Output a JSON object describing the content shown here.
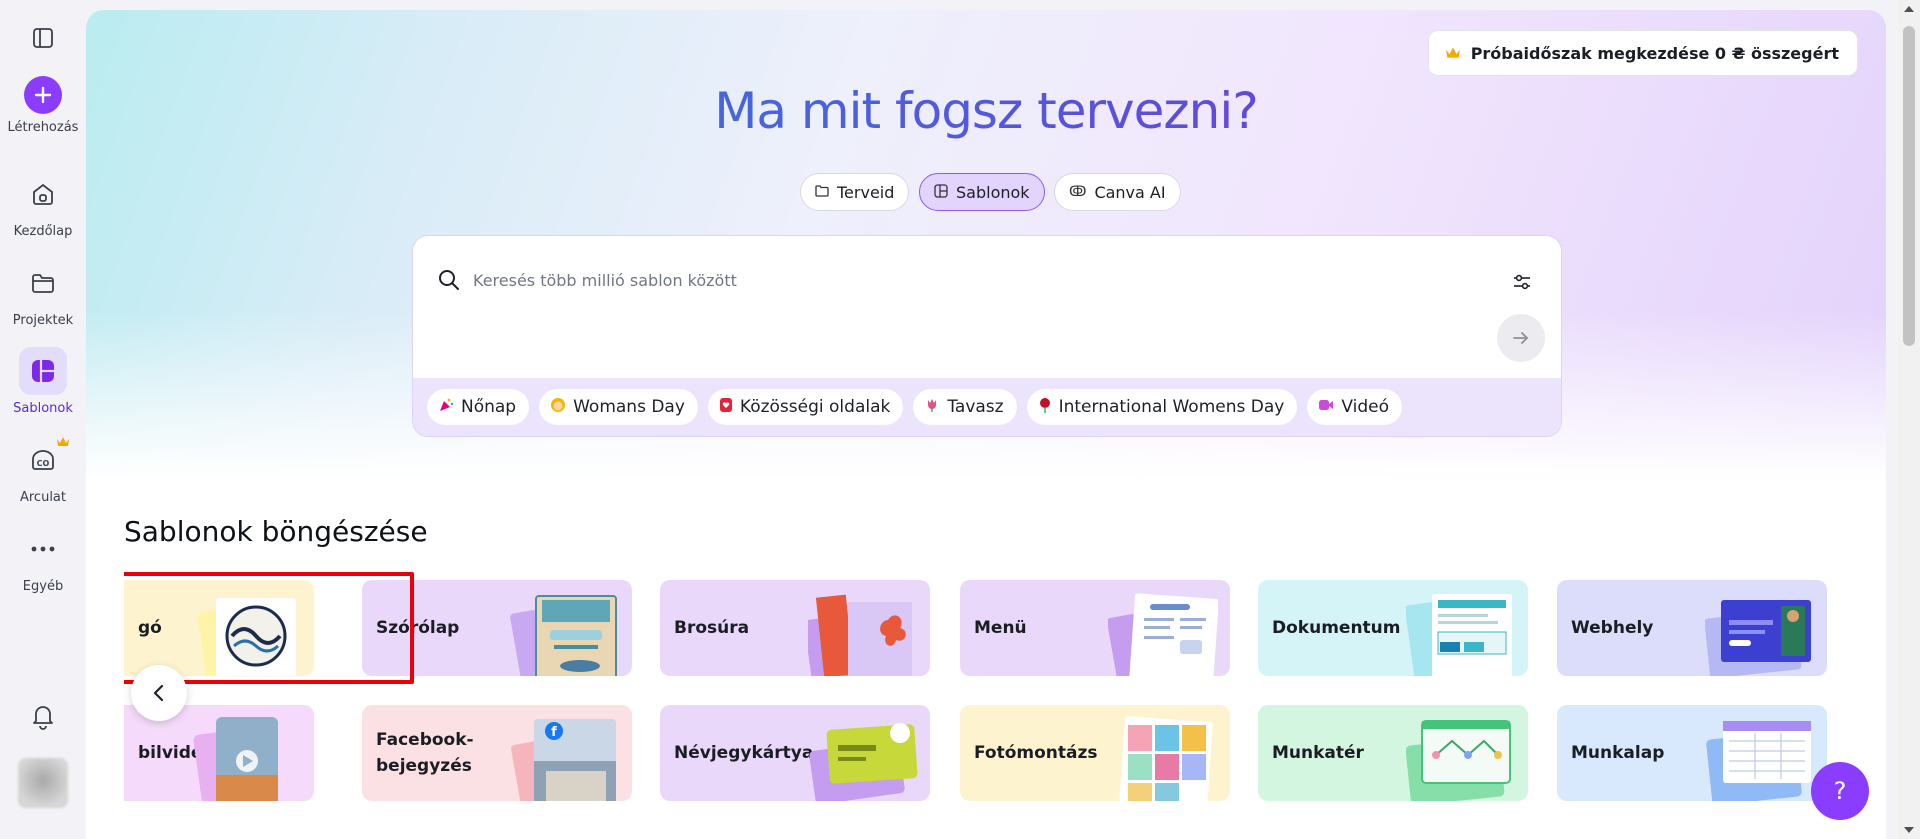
{
  "rail": {
    "items": [
      {
        "label": "Létrehozás",
        "icon": "plus-icon"
      },
      {
        "label": "Kezdőlap",
        "icon": "home-icon"
      },
      {
        "label": "Projektek",
        "icon": "folder-icon"
      },
      {
        "label": "Sablonok",
        "icon": "templates-icon",
        "active": true
      },
      {
        "label": "Arculat",
        "icon": "brand-icon",
        "premium": true
      },
      {
        "label": "Egyéb",
        "icon": "more-icon"
      }
    ]
  },
  "header": {
    "trial_label": "Próbaidőszak megkezdése 0 ₴ összegért"
  },
  "hero": {
    "title": "Ma mit fogsz tervezni?",
    "tabs": [
      {
        "label": "Terveid",
        "icon": "folder-icon"
      },
      {
        "label": "Sablonok",
        "icon": "template-icon",
        "active": true
      },
      {
        "label": "Canva AI",
        "icon": "ai-icon"
      }
    ]
  },
  "search": {
    "placeholder": "Keresés több millió sablon között",
    "chips": [
      {
        "label": "Nőnap",
        "icon": "party-icon",
        "color": "#e6007e"
      },
      {
        "label": "Womans Day",
        "icon": "woman-icon",
        "color": "#f4b400"
      },
      {
        "label": "Közösségi oldalak",
        "icon": "heart-icon",
        "color": "#e5213a"
      },
      {
        "label": "Tavasz",
        "icon": "tulip-icon",
        "color": "#ea4c89"
      },
      {
        "label": "International Womens Day",
        "icon": "rose-icon",
        "color": "#c0102a"
      },
      {
        "label": "Videó",
        "icon": "video-icon",
        "color": "#c94bd8"
      }
    ]
  },
  "browse": {
    "title": "Sablonok böngészése",
    "row1": [
      {
        "label": "gó",
        "bg": "#fdf4cf"
      },
      {
        "label": "Szórólap",
        "bg": "#ead8fb",
        "highlighted": true
      },
      {
        "label": "Brosúra",
        "bg": "#ead8fb"
      },
      {
        "label": "Menü",
        "bg": "#ead8fb"
      },
      {
        "label": "Dokumentum",
        "bg": "#d4f4f7"
      },
      {
        "label": "Webhely",
        "bg": "#dcdcfb"
      }
    ],
    "row2": [
      {
        "label": "bilvideó",
        "bg": "#f6dafb"
      },
      {
        "label": "Facebook-bejegyzés",
        "bg": "#fbe1e3"
      },
      {
        "label": "Névjegykártya",
        "bg": "#ead8fb"
      },
      {
        "label": "Fotómontázs",
        "bg": "#fdf4cf"
      },
      {
        "label": "Munkatér",
        "bg": "#d3f6e1"
      },
      {
        "label": "Munkalap",
        "bg": "#d8e9fd"
      }
    ]
  },
  "help": {
    "label": "?"
  }
}
